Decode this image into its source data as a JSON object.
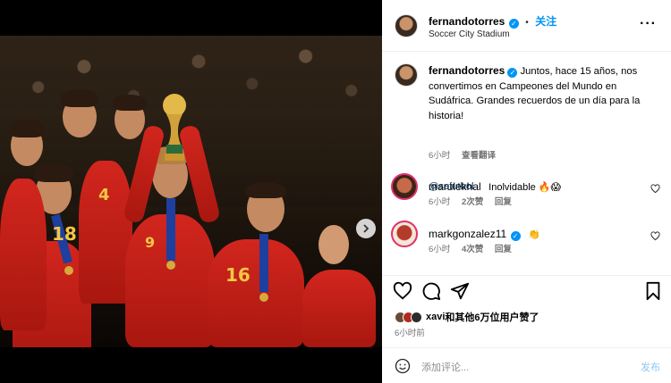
{
  "post": {
    "username": "fernandotorres",
    "follow_label": "关注",
    "separator": "•",
    "location": "Soccer City Stadium",
    "more_label": "···",
    "caption": "Juntos, hace 15 años, nos convertimos en Campeones del Mundo en Sudáfrica. Grandes recuerdos de un día para la historia!",
    "tag": "@sefutbol",
    "caption_time": "6小时",
    "see_translation": "查看翻译"
  },
  "photo": {
    "jersey_numbers": [
      "4",
      "9",
      "16",
      "18"
    ]
  },
  "comments": [
    {
      "username": "marulekhal",
      "text": "Inolvidable 🔥😱",
      "time": "6小时",
      "likes": "2次赞",
      "reply": "回复",
      "avatar_color": "#c66b4a"
    },
    {
      "username": "markgonzalez11",
      "text": "👏",
      "time": "6小时",
      "likes": "4次赞",
      "reply": "回复",
      "avatar_color": "#b43a2a"
    }
  ],
  "likes": {
    "text_prefix": "xavi",
    "text_rest": "和其他6万位用户赞了",
    "time": "6小时前"
  },
  "composer": {
    "placeholder": "添加评论...",
    "post_label": "发布"
  },
  "colors": {
    "accent": "#0095f6",
    "jersey": "#c81f17",
    "medal_ribbon": "#1e3f9e",
    "gold": "#d6a93c"
  }
}
